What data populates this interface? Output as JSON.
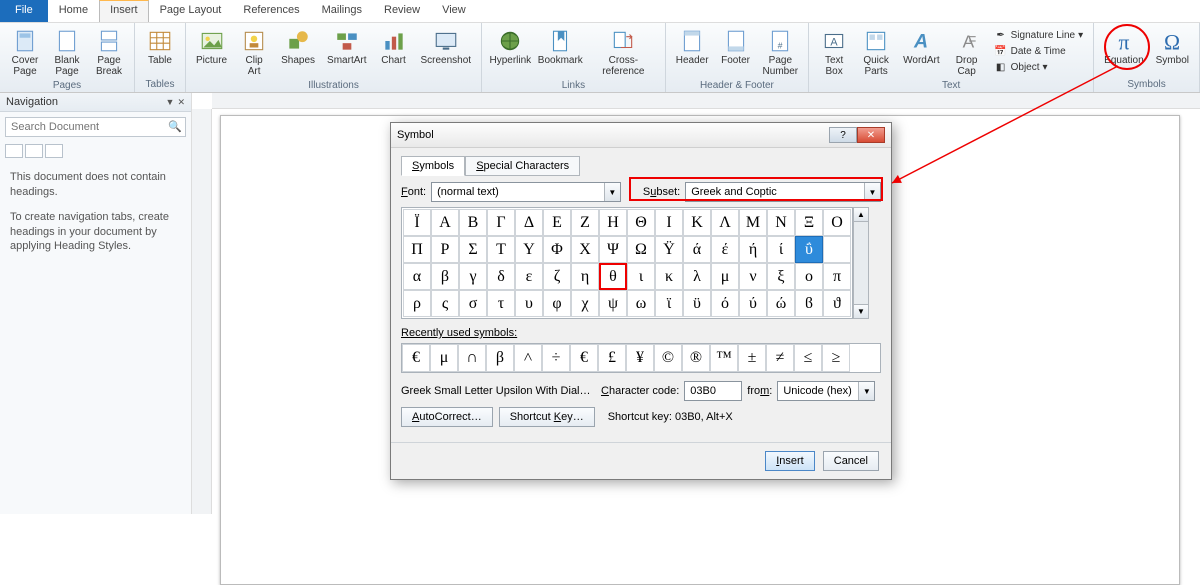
{
  "tabs": {
    "file": "File",
    "home": "Home",
    "insert": "Insert",
    "pagelayout": "Page Layout",
    "references": "References",
    "mailings": "Mailings",
    "review": "Review",
    "view": "View"
  },
  "ribbon": {
    "pages": {
      "label": "Pages",
      "cover": "Cover\nPage",
      "blank": "Blank\nPage",
      "break": "Page\nBreak"
    },
    "tables": {
      "label": "Tables",
      "table": "Table"
    },
    "illus": {
      "label": "Illustrations",
      "picture": "Picture",
      "clipart": "Clip\nArt",
      "shapes": "Shapes",
      "smartart": "SmartArt",
      "chart": "Chart",
      "screenshot": "Screenshot"
    },
    "links": {
      "label": "Links",
      "hyper": "Hyperlink",
      "bookmark": "Bookmark",
      "crossref": "Cross-reference"
    },
    "hf": {
      "label": "Header & Footer",
      "header": "Header",
      "footer": "Footer",
      "pagenum": "Page\nNumber"
    },
    "text": {
      "label": "Text",
      "textbox": "Text\nBox",
      "quick": "Quick\nParts",
      "wordart": "WordArt",
      "dropcap": "Drop\nCap",
      "sig": "Signature Line",
      "date": "Date & Time",
      "obj": "Object"
    },
    "symbols": {
      "label": "Symbols",
      "eq": "Equation",
      "sym": "Symbol"
    }
  },
  "nav": {
    "title": "Navigation",
    "search_ph": "Search Document",
    "p1": "This document does not contain headings.",
    "p2": "To create navigation tabs, create headings in your document by applying Heading Styles."
  },
  "dialog": {
    "title": "Symbol",
    "tabs": {
      "symbols": "Symbols",
      "special": "Special Characters"
    },
    "font_label": "Font:",
    "font_value": "(normal text)",
    "subset_label": "Subset:",
    "subset_value": "Greek and Coptic",
    "grid": [
      "Ϊ",
      "Α",
      "Β",
      "Γ",
      "Δ",
      "Ε",
      "Ζ",
      "Η",
      "Θ",
      "Ι",
      "Κ",
      "Λ",
      "Μ",
      "Ν",
      "Ξ",
      "Ο",
      "Π",
      "Ρ",
      "Σ",
      "Τ",
      "Υ",
      "Φ",
      "Χ",
      "Ψ",
      "Ω",
      "Ϋ",
      "ά",
      "έ",
      "ή",
      "ί",
      "ΰ",
      "",
      "α",
      "β",
      "γ",
      "δ",
      "ε",
      "ζ",
      "η",
      "θ",
      "ι",
      "κ",
      "λ",
      "μ",
      "ν",
      "ξ",
      "ο",
      "π",
      "ρ",
      "ς",
      "σ",
      "τ",
      "υ",
      "φ",
      "χ",
      "ψ",
      "ω",
      "ϊ",
      "ϋ",
      "ό",
      "ύ",
      "ώ",
      "ϐ",
      "ϑ"
    ],
    "recent_label": "Recently used symbols:",
    "recent": [
      "€",
      "μ",
      "∩",
      "β",
      "˄",
      "÷",
      "€",
      "£",
      "¥",
      "©",
      "®",
      "™",
      "±",
      "≠",
      "≤",
      "≥"
    ],
    "charname": "Greek Small Letter Upsilon With Dialyti…",
    "code_label": "Character code:",
    "code_value": "03B0",
    "from_label": "from:",
    "from_value": "Unicode (hex)",
    "autocorrect": "AutoCorrect…",
    "shortcutkey": "Shortcut Key…",
    "shortcut_info": "Shortcut key: 03B0, Alt+X",
    "insert": "Insert",
    "cancel": "Cancel"
  }
}
